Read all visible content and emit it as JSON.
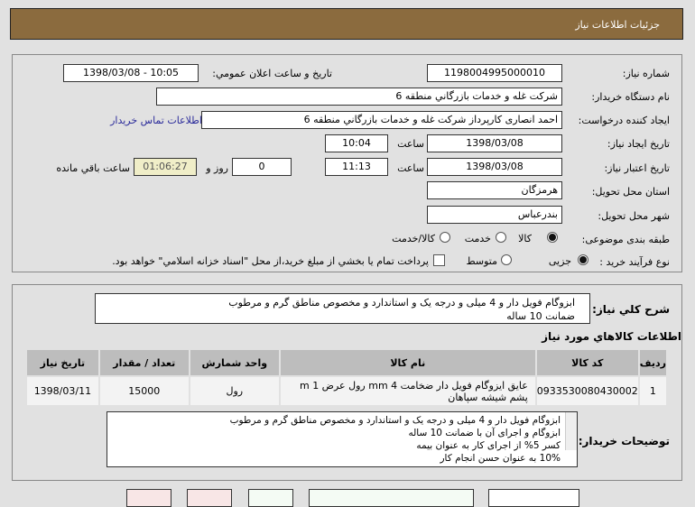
{
  "header": {
    "title": "جزئيات اطلاعات نياز"
  },
  "form": {
    "need_number_label": "شماره نياز:",
    "need_number": "1198004995000010",
    "announce_label": "تاريخ و ساعت اعلان عمومي:",
    "announce_value": "1398/03/08 - 10:05",
    "buyer_org_label": "نام دستگاه خريدار:",
    "buyer_org": "شرکت غله و خدمات بازرگاني منطقه 6",
    "creator_label": "ايجاد کننده درخواست:",
    "creator": "احمد انصاری کارپرداز شرکت غله و خدمات بازرگاني منطقه 6",
    "contact_link": "اطلاعات تماس خريدار",
    "created_date_label": "تاريخ ايجاد نياز:",
    "created_date": "1398/03/08",
    "time_label": "ساعت",
    "created_time": "10:04",
    "valid_date_label": "تاريخ اعتبار نياز:",
    "valid_date": "1398/03/08",
    "valid_time": "11:13",
    "days": "0",
    "days_label": "روز و",
    "remaining": "01:06:27",
    "remaining_label": "ساعت باقي مانده",
    "province_label": "استان محل تحويل:",
    "province": "هرمزگان",
    "city_label": "شهر محل تحويل:",
    "city": "بندرعباس",
    "category_label": "طبقه بندی موضوعی:",
    "category_options": [
      "کالا",
      "خدمت",
      "کالا/خدمت"
    ],
    "category_selected": "کالا",
    "process_label": "نوع فرآيند خريد :",
    "process_options": [
      "جزیی",
      "متوسط"
    ],
    "process_selected": "جزیی",
    "payment_note": "پرداخت تمام يا بخشي از مبلغ خريد،از محل \"اسناد خزانه اسلامي\" خواهد بود."
  },
  "summary": {
    "label": "شرح کلي نياز:",
    "lines": [
      "ابزوگام فویل دار و 4 میلی و درجه یک و استاندارد و مخصوص مناطق گرم و مرطوب",
      "ضمانت 10 ساله"
    ]
  },
  "goods": {
    "title": "اطلاعات کالاهاي مورد نياز",
    "columns": [
      "رديف",
      "کد کالا",
      "نام کالا",
      "واحد شمارش",
      "تعداد / مقدار",
      "تاريخ نياز"
    ],
    "rows": [
      {
        "row": "1",
        "code": "0933530080430002",
        "name": "عایق ایزوگام فویل دار ضخامت 4 mm رول عرض 1 m پشم شیشه سپاهان",
        "unit": "رول",
        "qty": "15000",
        "date": "1398/03/11"
      }
    ]
  },
  "buyer_notes": {
    "label": "توضيحات خريدار:",
    "lines": [
      "ابزوگام فویل دار و 4 میلی و درجه یک و استاندارد و مخصوص مناطق گرم و مرطوب",
      "ابزوگام و اجرای آن با ضمانت 10 ساله",
      "کسر 5% از اجرای کار به عنوان بیمه",
      "10% به عنوان حسن انجام کار"
    ]
  }
}
